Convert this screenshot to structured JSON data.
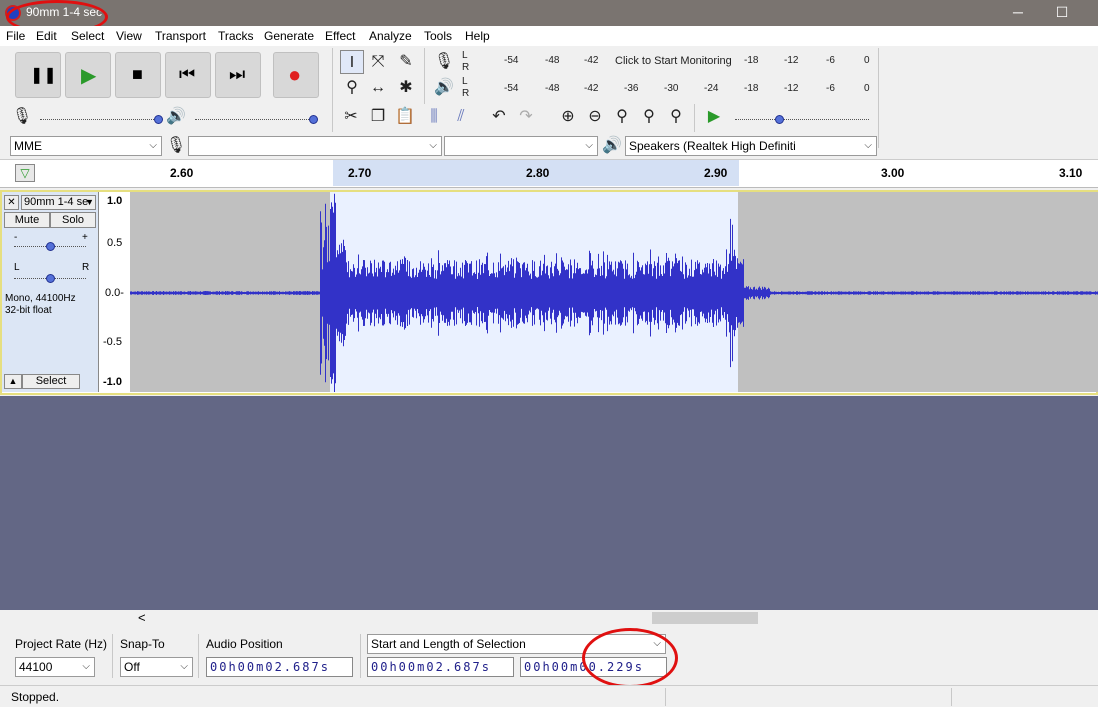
{
  "window": {
    "title": "90mm 1-4 sec",
    "minimize": "─",
    "maximize": "☐"
  },
  "menu": [
    "File",
    "Edit",
    "Select",
    "View",
    "Transport",
    "Tracks",
    "Generate",
    "Effect",
    "Analyze",
    "Tools",
    "Help"
  ],
  "transport": {
    "pause": "❚❚",
    "play": "▶",
    "stop": "■",
    "skip_start": "⏮",
    "skip_end": "⏭",
    "record": "●"
  },
  "meters": {
    "record_ticks": [
      "-54",
      "-48",
      "-42",
      "-18",
      "-12",
      "-6",
      "0"
    ],
    "record_message": "Click to Start Monitoring",
    "play_ticks": [
      "-54",
      "-48",
      "-42",
      "-36",
      "-30",
      "-24",
      "-18",
      "-12",
      "-6",
      "0"
    ],
    "L": "L",
    "R": "R"
  },
  "device": {
    "host": "MME",
    "record_device": "",
    "record_channels": "",
    "playback_device": "Speakers (Realtek High Definiti"
  },
  "ruler_ticks": [
    "2.60",
    "2.70",
    "2.80",
    "2.90",
    "3.00",
    "3.10"
  ],
  "track": {
    "name": "90mm 1-4 se",
    "mute": "Mute",
    "solo": "Solo",
    "gain_minus": "-",
    "gain_plus": "+",
    "pan_left": "L",
    "pan_right": "R",
    "info_line1": "Mono, 44100Hz",
    "info_line2": "32-bit float",
    "select": "Select",
    "close": "✕",
    "collapse": "▲",
    "vruler": [
      "1.0",
      "0.5",
      "0.0-",
      "-0.5",
      "-1.0"
    ]
  },
  "selection_bar": {
    "project_rate_label": "Project Rate (Hz)",
    "project_rate": "44100",
    "snap_to_label": "Snap-To",
    "snap_to": "Off",
    "audio_position_label": "Audio Position",
    "audio_position": "00h00m02.687s",
    "selection_mode": "Start and Length of Selection",
    "selection_start": "00h00m02.687s",
    "selection_length": "00h00m00.229s"
  },
  "status": "Stopped.",
  "scroll_left": "<",
  "colors": {
    "waveform": "#3232c8",
    "selection": "#eaf1ff",
    "background_empty": "#636785",
    "annotation": "#e01010"
  }
}
